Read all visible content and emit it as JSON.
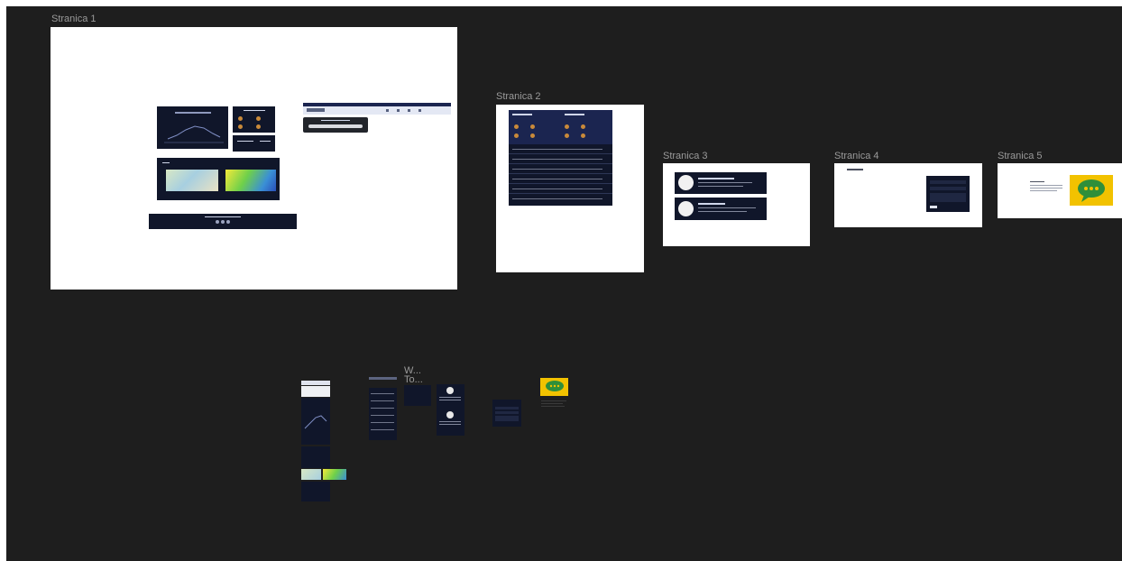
{
  "canvas": {
    "background": "#1e1e1e",
    "frame_labels": [
      "Stranica 1",
      "Stranica 2",
      "Stranica 3",
      "Stranica 4",
      "Stranica 5"
    ],
    "orphan_label": "W... To..."
  },
  "colors": {
    "frame_bg": "#ffffff",
    "card_dark": "#10162a",
    "card_navy": "#1b2550",
    "accent_yellow": "#f2c200",
    "bubble_green": "#2f8f3a"
  },
  "icons": [
    "chat-bubble-icon",
    "avatar-icon",
    "weather-icon"
  ]
}
